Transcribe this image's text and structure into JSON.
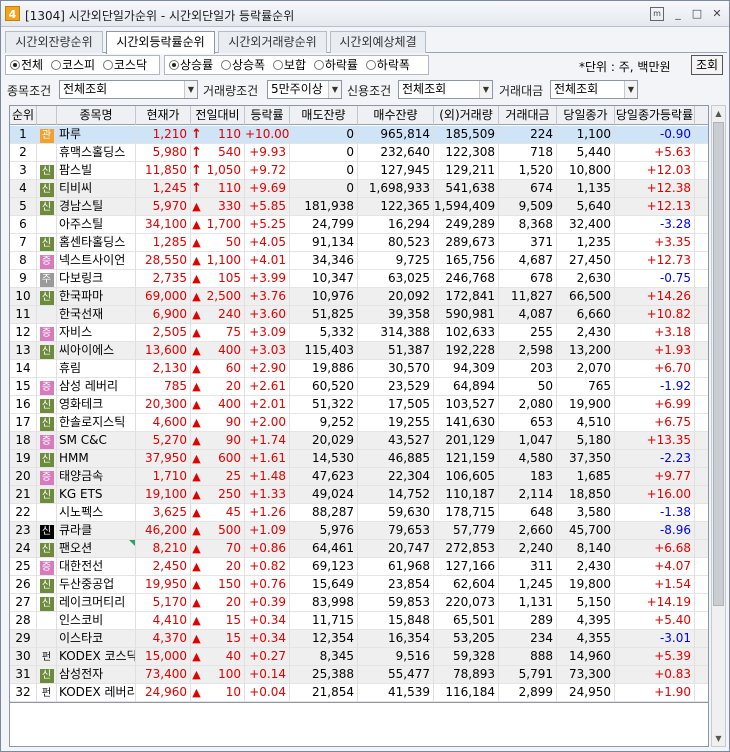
{
  "window": {
    "badge": "4",
    "title": "[1304] 시간외단일가순위 - 시간외단일가 등락률순위",
    "menu_icon": "m",
    "min": "_",
    "max": "□",
    "close": "✕"
  },
  "tabs": [
    "시간외잔량순위",
    "시간외등락률순위",
    "시간외거래량순위",
    "시간외예상체결"
  ],
  "market_filter": {
    "options": [
      "전체",
      "코스피",
      "코스닥"
    ],
    "selected": 0
  },
  "direction_filter": {
    "options": [
      "상승률",
      "상승폭",
      "보합",
      "하락률",
      "하락폭"
    ],
    "selected": 0
  },
  "unit_label": "*단위 : 주, 백만원",
  "lookup_button": "조회",
  "conditions": {
    "stock_cond_label": "종목조건",
    "stock_cond_value": "전체조회",
    "volume_cond_label": "거래량조건",
    "volume_cond_value": "5만주이상",
    "credit_cond_label": "신용조건",
    "credit_cond_value": "전체조회",
    "amount_cond_label": "거래대금",
    "amount_cond_value": "전체조회"
  },
  "columns": [
    "순위",
    "",
    "종목명",
    "현재가",
    "전일대비",
    "등락률",
    "매도잔량",
    "매수잔량",
    "(외)거래량",
    "거래대금",
    "당일종가",
    "당일종가등락률"
  ],
  "colors": {
    "up": "#e00000",
    "down": "#0000e0",
    "selected_row": "#cfe4f7"
  },
  "rows": [
    {
      "rank": "1",
      "tag": "관",
      "name": "파루",
      "price": "1,210",
      "arrow": "up-arrow",
      "diff": "110",
      "rate": "+10.00",
      "sell": "0",
      "buy": "965,814",
      "vol": "185,509",
      "amt": "224",
      "close": "1,100",
      "crate": "-0.90",
      "cdir": "down"
    },
    {
      "rank": "2",
      "tag": "",
      "name": "휴맥스홀딩스",
      "price": "5,980",
      "arrow": "up-arrow",
      "diff": "540",
      "rate": "+9.93",
      "sell": "0",
      "buy": "232,640",
      "vol": "122,308",
      "amt": "718",
      "close": "5,440",
      "crate": "+5.63",
      "cdir": "up"
    },
    {
      "rank": "3",
      "tag": "신",
      "name": "팜스빌",
      "price": "11,850",
      "arrow": "up-arrow",
      "diff": "1,050",
      "rate": "+9.72",
      "sell": "0",
      "buy": "127,945",
      "vol": "129,211",
      "amt": "1,520",
      "close": "10,800",
      "crate": "+12.03",
      "cdir": "up"
    },
    {
      "rank": "4",
      "tag": "신",
      "name": "티비씨",
      "price": "1,245",
      "arrow": "up-arrow",
      "diff": "110",
      "rate": "+9.69",
      "sell": "0",
      "buy": "1,698,933",
      "vol": "541,638",
      "amt": "674",
      "close": "1,135",
      "crate": "+12.38",
      "cdir": "up"
    },
    {
      "rank": "5",
      "tag": "신",
      "name": "경남스틸",
      "price": "5,970",
      "arrow": "up-triangle",
      "diff": "330",
      "rate": "+5.85",
      "sell": "181,938",
      "buy": "122,365",
      "vol": "1,594,409",
      "amt": "9,509",
      "close": "5,640",
      "crate": "+12.13",
      "cdir": "up"
    },
    {
      "rank": "6",
      "tag": "",
      "name": "아주스틸",
      "price": "34,100",
      "arrow": "up-triangle",
      "diff": "1,700",
      "rate": "+5.25",
      "sell": "24,799",
      "buy": "16,294",
      "vol": "249,289",
      "amt": "8,368",
      "close": "32,400",
      "crate": "-3.28",
      "cdir": "down"
    },
    {
      "rank": "7",
      "tag": "신",
      "name": "홈센타홀딩스",
      "price": "1,285",
      "arrow": "up-triangle",
      "diff": "50",
      "rate": "+4.05",
      "sell": "91,134",
      "buy": "80,523",
      "vol": "289,673",
      "amt": "371",
      "close": "1,235",
      "crate": "+3.35",
      "cdir": "up"
    },
    {
      "rank": "8",
      "tag": "증",
      "name": "넥스트사이언",
      "price": "28,550",
      "arrow": "up-triangle",
      "diff": "1,100",
      "rate": "+4.01",
      "sell": "34,346",
      "buy": "9,725",
      "vol": "165,756",
      "amt": "4,687",
      "close": "27,450",
      "crate": "+12.73",
      "cdir": "up"
    },
    {
      "rank": "9",
      "tag": "주",
      "name": "다보링크",
      "price": "2,735",
      "arrow": "up-triangle",
      "diff": "105",
      "rate": "+3.99",
      "sell": "10,347",
      "buy": "63,025",
      "vol": "246,768",
      "amt": "678",
      "close": "2,630",
      "crate": "-0.75",
      "cdir": "down"
    },
    {
      "rank": "10",
      "tag": "신",
      "name": "한국파마",
      "price": "69,000",
      "arrow": "up-triangle",
      "diff": "2,500",
      "rate": "+3.76",
      "sell": "10,976",
      "buy": "20,092",
      "vol": "172,841",
      "amt": "11,827",
      "close": "66,500",
      "crate": "+14.26",
      "cdir": "up"
    },
    {
      "rank": "11",
      "tag": "",
      "name": "한국선재",
      "price": "6,900",
      "arrow": "up-triangle",
      "diff": "240",
      "rate": "+3.60",
      "sell": "51,825",
      "buy": "39,358",
      "vol": "590,981",
      "amt": "4,087",
      "close": "6,660",
      "crate": "+10.82",
      "cdir": "up"
    },
    {
      "rank": "12",
      "tag": "증",
      "name": "자비스",
      "price": "2,505",
      "arrow": "up-triangle",
      "diff": "75",
      "rate": "+3.09",
      "sell": "5,332",
      "buy": "314,388",
      "vol": "102,633",
      "amt": "255",
      "close": "2,430",
      "crate": "+3.18",
      "cdir": "up"
    },
    {
      "rank": "13",
      "tag": "신",
      "name": "씨아이에스",
      "price": "13,600",
      "arrow": "up-triangle",
      "diff": "400",
      "rate": "+3.03",
      "sell": "115,403",
      "buy": "51,387",
      "vol": "192,228",
      "amt": "2,598",
      "close": "13,200",
      "crate": "+1.93",
      "cdir": "up"
    },
    {
      "rank": "14",
      "tag": "",
      "name": "휴림",
      "price": "2,130",
      "arrow": "up-triangle",
      "diff": "60",
      "rate": "+2.90",
      "sell": "19,886",
      "buy": "30,570",
      "vol": "94,309",
      "amt": "203",
      "close": "2,070",
      "crate": "+6.70",
      "cdir": "up"
    },
    {
      "rank": "15",
      "tag": "증",
      "name": "삼성 레버리",
      "price": "785",
      "arrow": "up-triangle",
      "diff": "20",
      "rate": "+2.61",
      "sell": "60,520",
      "buy": "23,529",
      "vol": "64,894",
      "amt": "50",
      "close": "765",
      "crate": "-1.92",
      "cdir": "down"
    },
    {
      "rank": "16",
      "tag": "신",
      "name": "영화테크",
      "price": "20,300",
      "arrow": "up-triangle",
      "diff": "400",
      "rate": "+2.01",
      "sell": "51,322",
      "buy": "17,505",
      "vol": "103,527",
      "amt": "2,080",
      "close": "19,900",
      "crate": "+6.99",
      "cdir": "up"
    },
    {
      "rank": "17",
      "tag": "신",
      "name": "한솔로지스틱",
      "price": "4,600",
      "arrow": "up-triangle",
      "diff": "90",
      "rate": "+2.00",
      "sell": "9,252",
      "buy": "19,255",
      "vol": "141,630",
      "amt": "653",
      "close": "4,510",
      "crate": "+6.75",
      "cdir": "up"
    },
    {
      "rank": "18",
      "tag": "증",
      "name": "SM C&C",
      "price": "5,270",
      "arrow": "up-triangle",
      "diff": "90",
      "rate": "+1.74",
      "sell": "20,029",
      "buy": "43,527",
      "vol": "201,129",
      "amt": "1,047",
      "close": "5,180",
      "crate": "+13.35",
      "cdir": "up"
    },
    {
      "rank": "19",
      "tag": "신",
      "name": "HMM",
      "price": "37,950",
      "arrow": "up-triangle",
      "diff": "600",
      "rate": "+1.61",
      "sell": "14,530",
      "buy": "46,885",
      "vol": "121,159",
      "amt": "4,580",
      "close": "37,350",
      "crate": "-2.23",
      "cdir": "down"
    },
    {
      "rank": "20",
      "tag": "증",
      "name": "태양금속",
      "price": "1,710",
      "arrow": "up-triangle",
      "diff": "25",
      "rate": "+1.48",
      "sell": "47,623",
      "buy": "22,304",
      "vol": "106,605",
      "amt": "183",
      "close": "1,685",
      "crate": "+9.77",
      "cdir": "up"
    },
    {
      "rank": "21",
      "tag": "신",
      "name": "KG ETS",
      "price": "19,100",
      "arrow": "up-triangle",
      "diff": "250",
      "rate": "+1.33",
      "sell": "49,024",
      "buy": "14,752",
      "vol": "110,187",
      "amt": "2,114",
      "close": "18,850",
      "crate": "+16.00",
      "cdir": "up"
    },
    {
      "rank": "22",
      "tag": "",
      "name": "시노펙스",
      "price": "3,625",
      "arrow": "up-triangle",
      "diff": "45",
      "rate": "+1.26",
      "sell": "88,287",
      "buy": "59,630",
      "vol": "178,715",
      "amt": "648",
      "close": "3,580",
      "crate": "-1.38",
      "cdir": "down"
    },
    {
      "rank": "23",
      "tag": "신",
      "name": "큐라클",
      "price": "46,200",
      "arrow": "up-triangle",
      "diff": "500",
      "rate": "+1.09",
      "sell": "5,976",
      "buy": "79,653",
      "vol": "57,779",
      "amt": "2,660",
      "close": "45,700",
      "crate": "-8.96",
      "cdir": "down"
    },
    {
      "rank": "24",
      "tag": "신",
      "name": "팬오션",
      "price": "8,210",
      "arrow": "up-triangle",
      "diff": "70",
      "rate": "+0.86",
      "sell": "64,461",
      "buy": "20,747",
      "vol": "272,853",
      "amt": "2,240",
      "close": "8,140",
      "crate": "+6.68",
      "cdir": "up"
    },
    {
      "rank": "25",
      "tag": "증",
      "name": "대한전선",
      "price": "2,450",
      "arrow": "up-triangle",
      "diff": "20",
      "rate": "+0.82",
      "sell": "69,123",
      "buy": "61,968",
      "vol": "127,166",
      "amt": "311",
      "close": "2,430",
      "crate": "+4.07",
      "cdir": "up"
    },
    {
      "rank": "26",
      "tag": "신",
      "name": "두산중공업",
      "price": "19,950",
      "arrow": "up-triangle",
      "diff": "150",
      "rate": "+0.76",
      "sell": "15,649",
      "buy": "23,854",
      "vol": "62,604",
      "amt": "1,245",
      "close": "19,800",
      "crate": "+1.54",
      "cdir": "up"
    },
    {
      "rank": "27",
      "tag": "신",
      "name": "레이크머티리",
      "price": "5,170",
      "arrow": "up-triangle",
      "diff": "20",
      "rate": "+0.39",
      "sell": "83,998",
      "buy": "59,853",
      "vol": "220,073",
      "amt": "1,131",
      "close": "5,150",
      "crate": "+14.19",
      "cdir": "up"
    },
    {
      "rank": "28",
      "tag": "",
      "name": "인스코비",
      "price": "4,410",
      "arrow": "up-triangle",
      "diff": "15",
      "rate": "+0.34",
      "sell": "11,715",
      "buy": "15,848",
      "vol": "65,501",
      "amt": "289",
      "close": "4,395",
      "crate": "+5.40",
      "cdir": "up"
    },
    {
      "rank": "29",
      "tag": "",
      "name": "이스타코",
      "price": "4,370",
      "arrow": "up-triangle",
      "diff": "15",
      "rate": "+0.34",
      "sell": "12,354",
      "buy": "16,354",
      "vol": "53,205",
      "amt": "234",
      "close": "4,355",
      "crate": "-3.01",
      "cdir": "down"
    },
    {
      "rank": "30",
      "tag": "펀",
      "name": "KODEX 코스닥",
      "price": "15,000",
      "arrow": "up-triangle",
      "diff": "40",
      "rate": "+0.27",
      "sell": "8,345",
      "buy": "9,516",
      "vol": "59,328",
      "amt": "888",
      "close": "14,960",
      "crate": "+5.39",
      "cdir": "up"
    },
    {
      "rank": "31",
      "tag": "신",
      "name": "삼성전자",
      "price": "73,400",
      "arrow": "up-triangle",
      "diff": "100",
      "rate": "+0.14",
      "sell": "25,388",
      "buy": "55,477",
      "vol": "78,893",
      "amt": "5,791",
      "close": "73,300",
      "crate": "+0.83",
      "cdir": "up"
    },
    {
      "rank": "32",
      "tag": "펀",
      "name": "KODEX 레버리",
      "price": "24,960",
      "arrow": "up-triangle",
      "diff": "10",
      "rate": "+0.04",
      "sell": "21,854",
      "buy": "41,539",
      "vol": "116,184",
      "amt": "2,899",
      "close": "24,950",
      "crate": "+1.90",
      "cdir": "up"
    }
  ]
}
